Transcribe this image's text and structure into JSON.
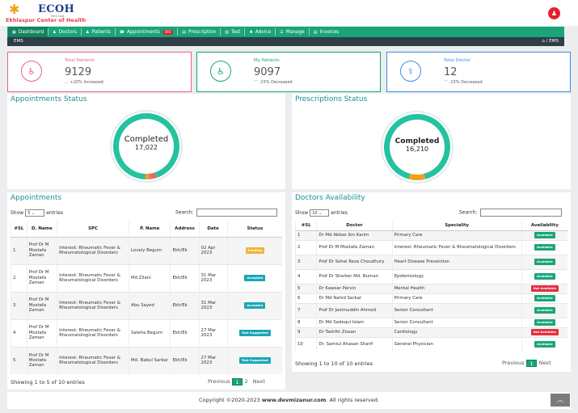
{
  "brand": {
    "name": "ECOH",
    "since": "ESTD 1998",
    "subtitle": "Ekhlaspur Center of Health"
  },
  "nav": [
    {
      "icon": "dashboard-icon",
      "glyph": "▦",
      "label": "Dashboard"
    },
    {
      "icon": "doctor-icon",
      "glyph": "♟",
      "label": "Doctors"
    },
    {
      "icon": "patients-icon",
      "glyph": "♟",
      "label": "Patients"
    },
    {
      "icon": "appointments-icon",
      "glyph": "☎",
      "label": "Appointments",
      "badge": "593"
    },
    {
      "icon": "prescription-icon",
      "glyph": "▤",
      "label": "Prescription"
    },
    {
      "icon": "test-icon",
      "glyph": "▥",
      "label": "Test"
    },
    {
      "icon": "advice-icon",
      "glyph": "♣",
      "label": "Advice"
    },
    {
      "icon": "manage-icon",
      "glyph": "☰",
      "label": "Manage"
    },
    {
      "icon": "invoices-icon",
      "glyph": "▤",
      "label": "Invoices"
    }
  ],
  "breadcrumb": {
    "left": "EMS",
    "home_glyph": "⌂",
    "right": "/ EMS"
  },
  "stats": [
    {
      "label": "Total Patients",
      "value": "9129",
      "arrow": "︿",
      "change": "+20% Increased",
      "color": "#e4629a",
      "icon": "wheelchair-icon",
      "glyph": "♿"
    },
    {
      "label": "My Patients",
      "value": "9097",
      "arrow": "﹀",
      "change": "-15% Decreased",
      "color": "#19a47a",
      "icon": "wheelchair-icon",
      "glyph": "♿"
    },
    {
      "label": "Total Doctor",
      "value": "12",
      "arrow": "﹀",
      "change": "-15% Decreased",
      "color": "#3b8fe0",
      "icon": "doctor-icon",
      "glyph": "⚕"
    }
  ],
  "appointments_status": {
    "title": "Appointments Status",
    "label": "Completed",
    "value": "17,022",
    "segments": [
      {
        "fraction": 0.9,
        "color": "#25c2a0"
      },
      {
        "fraction": 0.035,
        "color": "#e86a6a"
      },
      {
        "fraction": 0.02,
        "color": "#f0a01c"
      },
      {
        "fraction": 0.045,
        "color": "#25c2a0"
      }
    ]
  },
  "prescriptions_status": {
    "title": "Prescriptions Status",
    "label": "Completed",
    "value": "16,210",
    "segments": [
      {
        "fraction": 0.92,
        "color": "#25c2a0"
      },
      {
        "fraction": 0.08,
        "color": "#f0a01c"
      }
    ]
  },
  "appointments": {
    "title": "Appointments",
    "show_label": "Show",
    "entries_label": "entries",
    "page_size": "5",
    "search_label": "Search:",
    "columns": [
      "#SL",
      "D. Name",
      "SPC",
      "P. Name",
      "Address",
      "Date",
      "Status"
    ],
    "rows": [
      {
        "sl": "1",
        "doctor": "Prof Dr M Mostafa Zaman",
        "spc": "Interest: Rheumatic Fever & Rheumatological Disorders",
        "patient": "Lovely Begum",
        "address": "Ekh/Ek",
        "date": "02 Apr 2023",
        "status": "Pending",
        "status_color": "#f0b43c"
      },
      {
        "sl": "2",
        "doctor": "Prof Dr M Mostafa Zaman",
        "spc": "Interest: Rheumatic Fever & Rheumatological Disorders",
        "patient": "Md Zilani",
        "address": "Ekh/Ek",
        "date": "31 Mar 2023",
        "status": "Accepted",
        "status_color": "#1aa6b7"
      },
      {
        "sl": "3",
        "doctor": "Prof Dr M Mostafa Zaman",
        "spc": "Interest: Rheumatic Fever & Rheumatological Disorders",
        "patient": "Abu Sayed",
        "address": "Ekh/Ek",
        "date": "31 Mar 2023",
        "status": "Accepted",
        "status_color": "#1aa6b7"
      },
      {
        "sl": "4",
        "doctor": "Prof Dr M Mostafa Zaman",
        "spc": "Interest: Rheumatic Fever & Rheumatological Disorders",
        "patient": "Saleha Begum",
        "address": "Ekh/Ek",
        "date": "27 Mar 2023",
        "status": "Test Suggested",
        "status_color": "#1aa6b7"
      },
      {
        "sl": "5",
        "doctor": "Prof Dr M Mostafa Zaman",
        "spc": "Interest: Rheumatic Fever & Rheumatological Disorders",
        "patient": "Md. Babul Sarkar",
        "address": "Ekh/Ek",
        "date": "27 Mar 2023",
        "status": "Test Suggested",
        "status_color": "#1aa6b7"
      }
    ],
    "info": "Showing 1 to 5 of 10 entries",
    "pager": {
      "prev": "Previous",
      "pages": [
        "1",
        "2"
      ],
      "next": "Next"
    }
  },
  "doctors": {
    "title": "Doctors Availability",
    "show_label": "Show",
    "entries_label": "entries",
    "page_size": "10",
    "search_label": "Search:",
    "columns": [
      "#SL",
      "Doctor",
      "Speciality",
      "Availability"
    ],
    "rows": [
      {
        "sl": "1",
        "doctor": "Dr Md Abbas Ibn Karim",
        "speciality": "Primary Care",
        "status": "Available",
        "color": "#19a47a"
      },
      {
        "sl": "2",
        "doctor": "Prof Dr M Mostafa Zaman",
        "speciality": "Interest: Rheumatic Fever & Rheumatological Disorders",
        "status": "Available",
        "color": "#19a47a"
      },
      {
        "sl": "3",
        "doctor": "Prof Dr Sohel Reza Choudhury",
        "speciality": "Heart Disease Prevention",
        "status": "Available",
        "color": "#19a47a"
      },
      {
        "sl": "4",
        "doctor": "Prof Dr Sharker Md. Numan",
        "speciality": "Epidemiology",
        "status": "Available",
        "color": "#19a47a"
      },
      {
        "sl": "5",
        "doctor": "Dr Kawsar Parvin",
        "speciality": "Mental Health",
        "status": "Not Available",
        "color": "#e3303c"
      },
      {
        "sl": "6",
        "doctor": "Dr Md Nahid Sarkar",
        "speciality": "Primary Care",
        "status": "Available",
        "color": "#19a47a"
      },
      {
        "sl": "7",
        "doctor": "Prof Dr Jasimuddin Ahmed",
        "speciality": "Senior Consultant",
        "status": "Available",
        "color": "#19a47a"
      },
      {
        "sl": "8",
        "doctor": "Dr Md Sadequl Islam",
        "speciality": "Senior Consultant",
        "status": "Available",
        "color": "#19a47a"
      },
      {
        "sl": "9",
        "doctor": "Dr Tashfin Zissan",
        "speciality": "Cardiology",
        "status": "Not Available",
        "color": "#e3303c"
      },
      {
        "sl": "10",
        "doctor": "Dr. Samiul Ahasan Sharif",
        "speciality": "General Physician",
        "status": "Available",
        "color": "#19a47a"
      }
    ],
    "info": "Showing 1 to 10 of 10 entries",
    "pager": {
      "prev": "Previous",
      "pages": [
        "1"
      ],
      "next": "Next"
    }
  },
  "footer": {
    "prefix": "Copyright ©2020-2023 ",
    "site": "www.devmizanur.com",
    "suffix": ". All rights reserved."
  },
  "scroll_top_glyph": "︿",
  "user_glyph": "♟"
}
